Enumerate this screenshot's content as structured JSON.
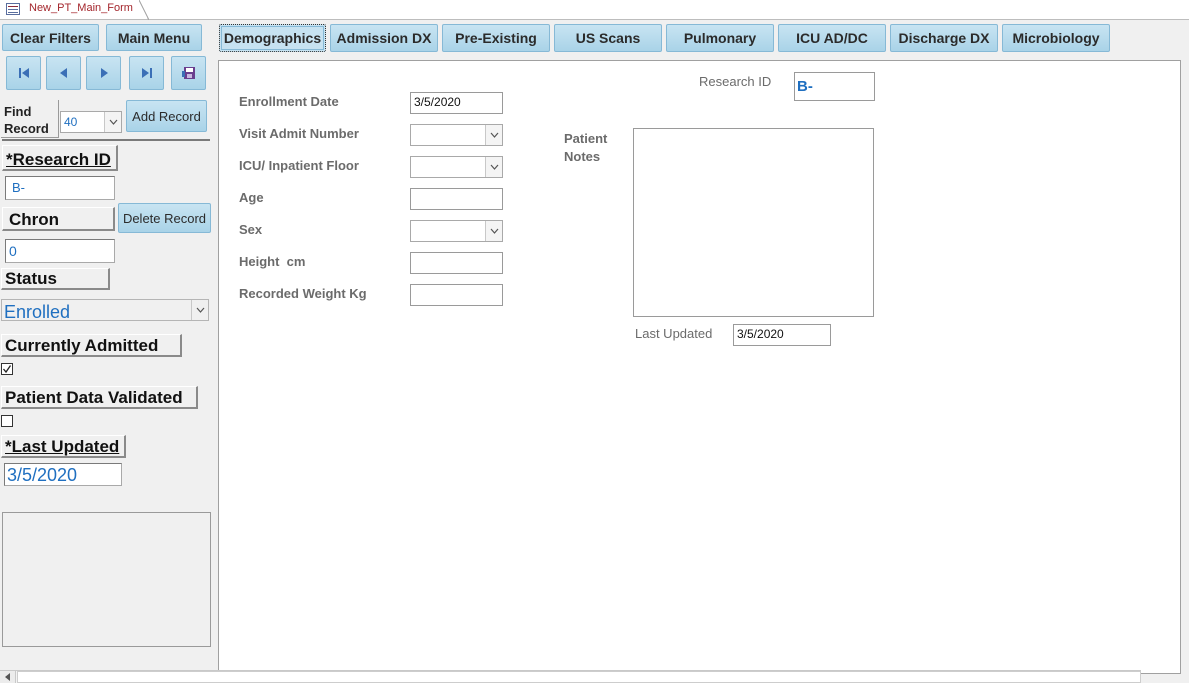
{
  "document_tab": {
    "title": "New_PT_Main_Form"
  },
  "toolbar": {
    "clear_filters": "Clear Filters",
    "main_menu": "Main Menu"
  },
  "tabs": [
    {
      "label": "Demographics",
      "active": true
    },
    {
      "label": "Admission DX"
    },
    {
      "label": "Pre-Existing"
    },
    {
      "label": "US Scans"
    },
    {
      "label": "Pulmonary"
    },
    {
      "label": "ICU AD/DC"
    },
    {
      "label": "Discharge DX"
    },
    {
      "label": "Microbiology"
    }
  ],
  "nav_icons": [
    "first-record-icon",
    "previous-record-icon",
    "next-record-icon",
    "last-record-icon",
    "save-record-icon"
  ],
  "left_pane": {
    "find_record_line1": "Find",
    "find_record_line2": "Record",
    "find_record_value": "40",
    "add_record": "Add Record",
    "research_id_label": "*Research ID",
    "research_id_value": "B-",
    "chron_label": "Chron",
    "delete_record": "Delete Record",
    "chron_value": "0",
    "status_label": "Status",
    "status_value": "Enrolled",
    "currently_admitted_label": "Currently Admitted",
    "currently_admitted_checked": true,
    "patient_data_validated_label": "Patient Data Validated",
    "patient_data_validated_checked": false,
    "last_updated_label": "*Last Updated",
    "last_updated_value": "3/5/2020"
  },
  "demographics": {
    "research_id_label": "Research ID",
    "research_id_value": "B-",
    "enrollment_date_label": "Enrollment Date",
    "enrollment_date_value": "3/5/2020",
    "visit_admit_number_label": "Visit Admit Number",
    "icu_floor_label": "ICU/ Inpatient Floor",
    "age_label": "Age",
    "sex_label": "Sex",
    "height_label": "Height  cm",
    "weight_label": "Recorded Weight Kg",
    "patient_notes_label_line1": "Patient",
    "patient_notes_label_line2": "Notes",
    "last_updated_label": "Last Updated",
    "last_updated_value": "3/5/2020"
  },
  "colors": {
    "button_fill": "#a9d3e8",
    "value_blue": "#1f6fc0",
    "tab_title_red": "#a4262c"
  }
}
